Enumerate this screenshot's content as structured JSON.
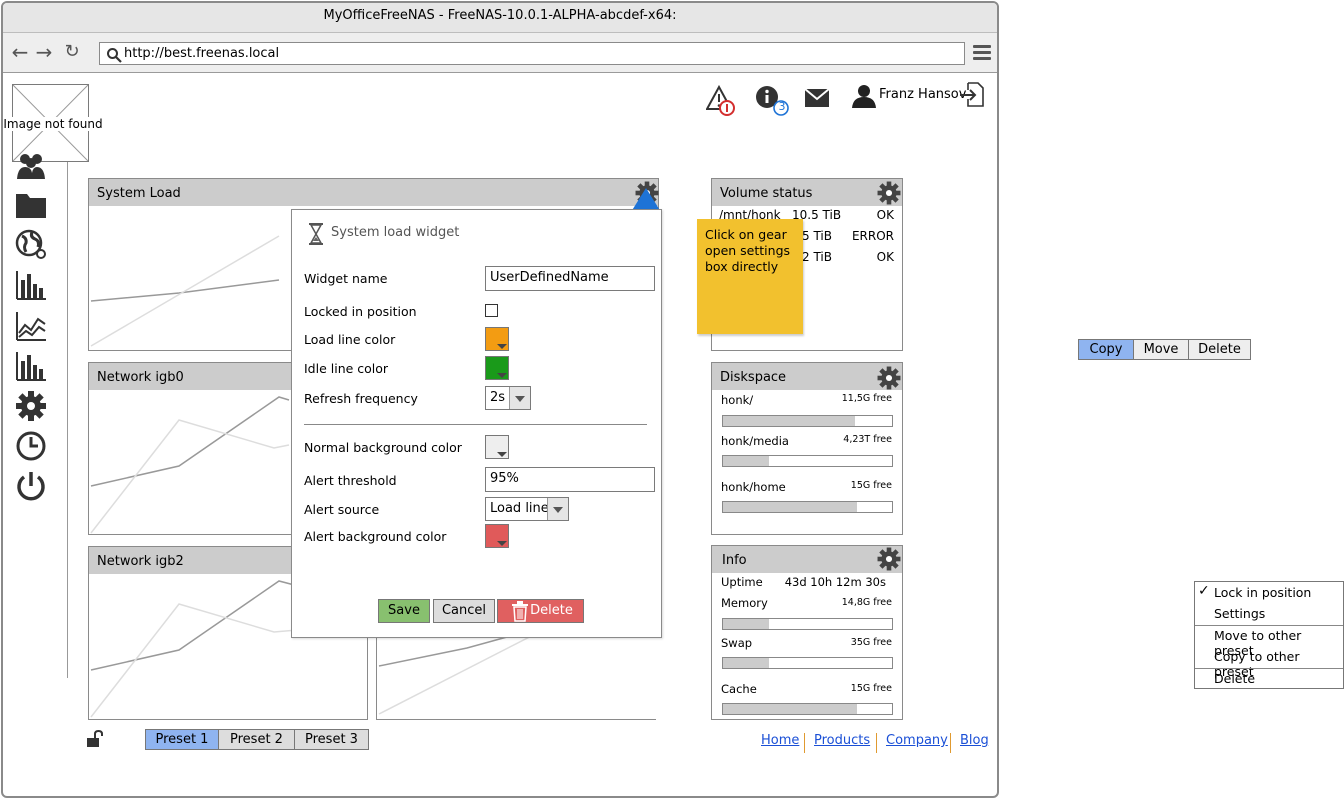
{
  "window": {
    "title": "MyOfficeFreeNAS - FreeNAS-10.0.1-ALPHA-abcdef-x64:",
    "url": "http://best.freenas.local"
  },
  "logo": {
    "placeholder_text": "Image not found"
  },
  "header": {
    "alerts_badge": "!",
    "info_badge": "3",
    "user_name": "Franz Hansov"
  },
  "widgets": {
    "system_load": {
      "title": "System Load"
    },
    "network_igb0": {
      "title": "Network igb0"
    },
    "network_igb2": {
      "title": "Network igb2"
    },
    "volume_status": {
      "title": "Volume status",
      "rows": [
        {
          "path": "/mnt/honk",
          "size": "10.5 TiB",
          "status": "OK"
        },
        {
          "path": "",
          "size": "5 TiB",
          "status": "ERROR"
        },
        {
          "path": "",
          "size": "2 TiB",
          "status": "OK"
        }
      ]
    },
    "diskspace": {
      "title": "Diskspace",
      "rows": [
        {
          "name": "honk/",
          "free": "11,5G free",
          "usage": 0.78
        },
        {
          "name": "honk/media",
          "free": "4,23T free",
          "usage": 0.27
        },
        {
          "name": "honk/home",
          "free": "15G free",
          "usage": 0.79
        }
      ]
    },
    "info": {
      "title": "Info",
      "uptime_label": "Uptime",
      "uptime_value": "43d 10h 12m 30s",
      "memory_label": "Memory",
      "memory_free": "14,8G free",
      "memory_usage": 0.27,
      "swap_label": "Swap",
      "swap_free": "35G free",
      "swap_usage": 0.27,
      "cache_label": "Cache",
      "cache_free": "15G free",
      "cache_usage": 0.79
    }
  },
  "dialog": {
    "title": "System load widget",
    "widget_name_label": "Widget name",
    "widget_name_value": "UserDefinedName",
    "locked_label": "Locked in position",
    "load_color_label": "Load line color",
    "load_color": "#f39c12",
    "idle_color_label": "Idle line color",
    "idle_color": "#1a9a1a",
    "refresh_label": "Refresh frequency",
    "refresh_value": "2s",
    "normal_bg_label": "Normal background color",
    "normal_bg_color": "#eeeeee",
    "alert_threshold_label": "Alert threshold",
    "alert_threshold_value": "95%",
    "alert_source_label": "Alert source",
    "alert_source_value": "Load line",
    "alert_bg_label": "Alert background color",
    "alert_bg_color": "#e05a5a",
    "save_label": "Save",
    "cancel_label": "Cancel",
    "delete_label": "Delete"
  },
  "sticky_note": {
    "text_line1": "Click on gear",
    "text_line2": "open settings",
    "text_line3": "box directly"
  },
  "presets": [
    "Preset 1",
    "Preset 2",
    "Preset 3"
  ],
  "footer_links": [
    "Home",
    "Products",
    "Company",
    "Blog"
  ],
  "segmented_buttons": [
    "Copy",
    "Move",
    "Delete"
  ],
  "context_menu": {
    "check_mark": "✓",
    "items": [
      "Lock in position",
      "Settings",
      "Move to other preset",
      "Copy to other preset",
      "Delete"
    ]
  },
  "colors": {
    "accent_blue": "#8fb4f0",
    "save_green": "#88c06f",
    "delete_red": "#e06060",
    "sticky_yellow": "#f2c12e",
    "header_gray": "#cccccc"
  }
}
